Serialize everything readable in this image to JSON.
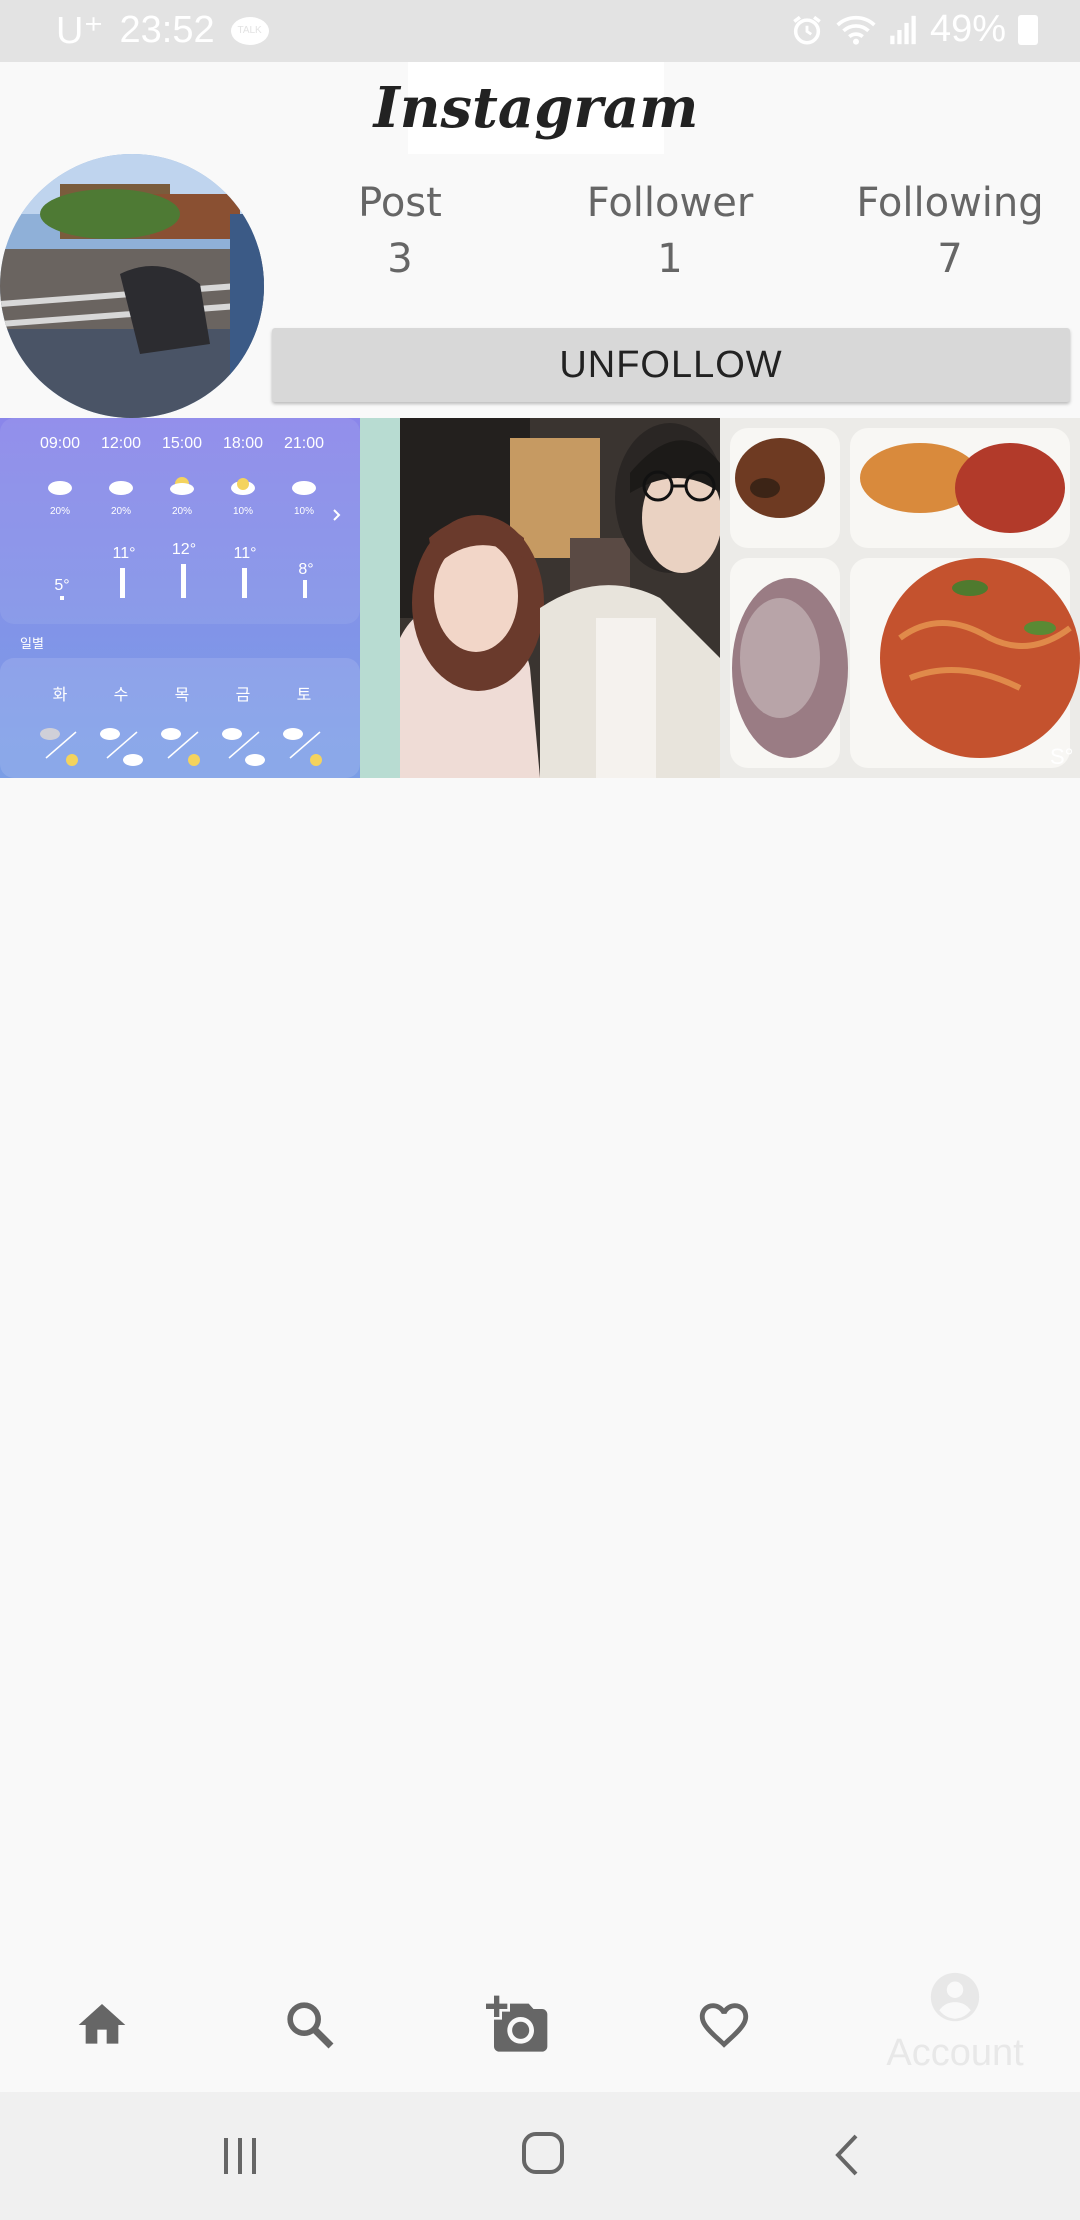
{
  "status_bar": {
    "carrier": "U⁺",
    "time": "23:52",
    "battery": "49%"
  },
  "app": {
    "logo_text": "Instagram"
  },
  "profile": {
    "stats": [
      {
        "label": "Post",
        "value": "3"
      },
      {
        "label": "Follower",
        "value": "1"
      },
      {
        "label": "Following",
        "value": "7"
      }
    ],
    "unfollow_label": "UNFOLLOW"
  },
  "posts": {
    "weather": {
      "hours": [
        "09:00",
        "12:00",
        "15:00",
        "18:00",
        "21:00"
      ],
      "precip": [
        "20%",
        "20%",
        "20%",
        "10%",
        "10%"
      ],
      "temps": [
        "5°",
        "11°",
        "12°",
        "11°",
        "8°"
      ],
      "section_label": "일별",
      "days": [
        "화",
        "수",
        "목",
        "금",
        "토"
      ]
    },
    "food_watermark": "S°"
  },
  "bottom_nav": {
    "items": [
      {
        "icon": "home-icon"
      },
      {
        "icon": "search-icon"
      },
      {
        "icon": "add-photo-icon"
      },
      {
        "icon": "heart-icon"
      },
      {
        "icon": "account-icon",
        "label": "Account"
      }
    ]
  },
  "system_nav": {
    "icons": [
      "recent-apps-icon",
      "home-circle-icon",
      "back-icon"
    ]
  },
  "colors": {
    "background": "#f9f9f9",
    "status_bar": "#e3e3e3",
    "button": "#d8d8d8",
    "icon": "#666666",
    "weather_top": "#8a86ea",
    "weather_bottom": "#7b9ee6"
  }
}
